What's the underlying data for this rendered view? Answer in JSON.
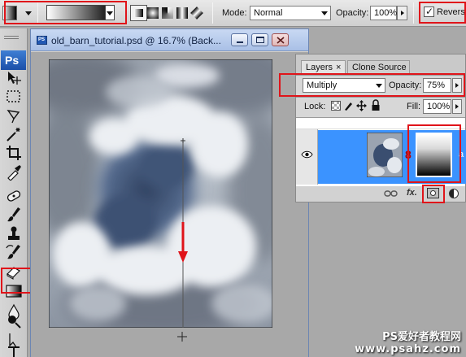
{
  "options_bar": {
    "mode_label": "Mode:",
    "mode_value": "Normal",
    "opacity_label": "Opacity:",
    "opacity_value": "100%",
    "reverse_label": "Reverse",
    "reverse_checked": true
  },
  "document": {
    "title": "old_barn_tutorial.psd @ 16.7% (Back...",
    "app_badge": "PS",
    "minimize_icon": "minimize-icon",
    "maximize_icon": "maximize-icon",
    "close_icon": "close-icon"
  },
  "toolbox": {
    "app_logo": "Ps",
    "tools": [
      "move-tool-icon",
      "marquee-tool-icon",
      "lasso-tool-icon",
      "magic-wand-tool-icon",
      "crop-tool-icon",
      "eyedropper-tool-icon",
      "healing-brush-tool-icon",
      "brush-tool-icon",
      "clone-stamp-tool-icon",
      "history-brush-tool-icon",
      "eraser-tool-icon",
      "gradient-tool-icon",
      "blur-tool-icon",
      "dodge-tool-icon",
      "path-selection-tool-icon",
      "type-tool-icon"
    ],
    "active_tool": "gradient-tool-icon"
  },
  "layers_panel": {
    "tabs": [
      {
        "label": "Layers",
        "close": "×"
      },
      {
        "label": "Clone Source"
      }
    ],
    "blend_mode": "Multiply",
    "opacity_label": "Opacity:",
    "opacity_value": "75%",
    "lock_label": "Lock:",
    "fill_label": "Fill:",
    "fill_value": "100%",
    "layer_name_partial": "a",
    "footer_fx": "fx."
  },
  "watermark": {
    "line1": "PS爱好者教程网",
    "line2": "www.psahz.com"
  },
  "colors": {
    "highlight": "#e0141a",
    "selected_layer": "#3b93ff",
    "title_bar": "#b7cbea"
  }
}
